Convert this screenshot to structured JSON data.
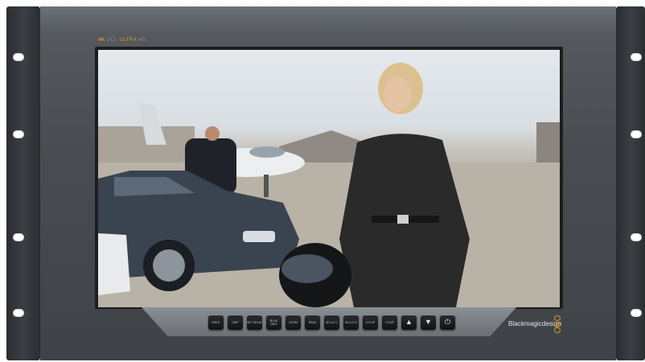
{
  "header": {
    "format_a": "4K",
    "format_b": "DCI",
    "format_c": "ULTRA",
    "format_d": "HD"
  },
  "controls": {
    "buttons": [
      {
        "label": "INPUT"
      },
      {
        "label": "DISP"
      },
      {
        "label": "SET DELAY"
      },
      {
        "label": "BLUE ONLY"
      },
      {
        "label": "ZOOM"
      },
      {
        "label": "PEAK"
      },
      {
        "label": "3D LUT 1"
      },
      {
        "label": "3D LUT 2"
      },
      {
        "label": "H FLIP"
      },
      {
        "label": "V FLIP"
      },
      {
        "label": "▲"
      },
      {
        "label": "▼"
      },
      {
        "label": "⏻"
      }
    ]
  },
  "brand": {
    "name": "Blackmagicdesign",
    "accent": "#d8922a"
  }
}
